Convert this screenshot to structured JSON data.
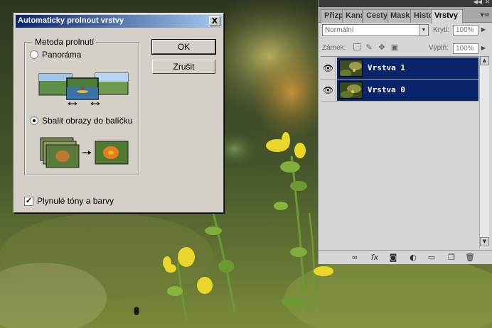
{
  "dialog": {
    "title": "Automaticky prolnout vrstvy",
    "close_glyph": "X",
    "group_label": "Metoda prolnutí",
    "option_panorama": "Panoráma",
    "option_stack": "Sbalit obrazy do balíčku",
    "selected_option": "Sbalit obrazy do balíčku",
    "checkbox_label": "Plynulé tóny a barvy",
    "checkbox_checked": true,
    "ok_label": "OK",
    "cancel_label": "Zrušit",
    "check_glyph": "✓"
  },
  "panel": {
    "tabs": [
      "Přizp",
      "Kaná",
      "Cesty",
      "Mask",
      "Histo",
      "Vrstvy"
    ],
    "active_tab": "Vrstvy",
    "blend_mode": "Normální",
    "opacity_label": "Krytí:",
    "opacity_value": "100%",
    "lock_label": "Zámek:",
    "fill_label": "Výplň:",
    "fill_value": "100%",
    "layers": [
      {
        "name": "Vrstva 1",
        "visible": true,
        "selected": true
      },
      {
        "name": "Vrstva 0",
        "visible": true,
        "selected": true
      }
    ],
    "bottom_icons": [
      "link-icon",
      "fx-icon",
      "mask-icon",
      "adjustment-icon",
      "folder-icon",
      "new-layer-icon",
      "trash-icon"
    ],
    "fx_glyph": "fx"
  },
  "colors": {
    "dialog_bg": "#d4d0c8",
    "titlebar_start": "#0a246a",
    "titlebar_end": "#a6caf0",
    "layer_selected": "#0a246a",
    "panel_bg": "#d6d6d6"
  }
}
